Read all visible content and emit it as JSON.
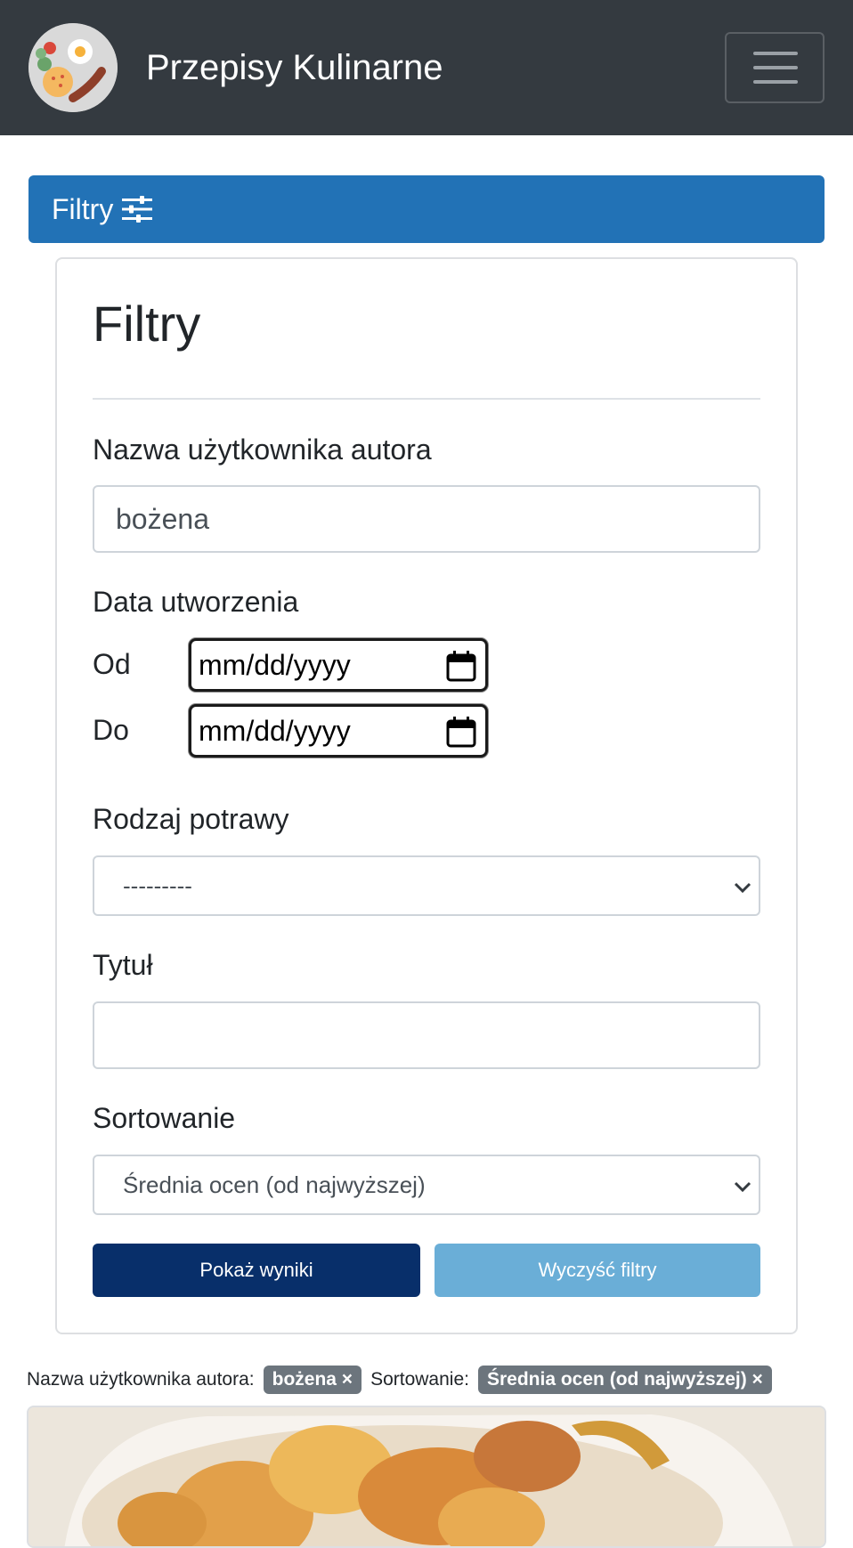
{
  "navbar": {
    "brand": "Przepisy Kulinarne"
  },
  "filter_toggle": {
    "label": "Filtry"
  },
  "filters": {
    "title": "Filtry",
    "author": {
      "label": "Nazwa użytkownika autora",
      "value": "bożena"
    },
    "created": {
      "label": "Data utworzenia",
      "from_label": "Od",
      "from_value": "mm/dd/yyyy",
      "to_label": "Do",
      "to_value": "mm/dd/yyyy"
    },
    "dish_type": {
      "label": "Rodzaj potrawy",
      "selected": "---------"
    },
    "title_field": {
      "label": "Tytuł",
      "value": ""
    },
    "sorting": {
      "label": "Sortowanie",
      "selected": "Średnia ocen (od najwyższej)"
    },
    "show_results_label": "Pokaż wyniki",
    "clear_filters_label": "Wyczyść filtry"
  },
  "active_filters": [
    {
      "label": "Nazwa użytkownika autora:",
      "value": "bożena ×"
    },
    {
      "label": "Sortowanie:",
      "value": "Średnia ocen (od najwyższej) ×"
    }
  ],
  "colors": {
    "navbar_bg": "#343a40",
    "filter_toggle_bg": "#2272b6",
    "primary_button": "#082f6a",
    "secondary_button": "#6aaed7",
    "badge_bg": "#6c757d"
  }
}
